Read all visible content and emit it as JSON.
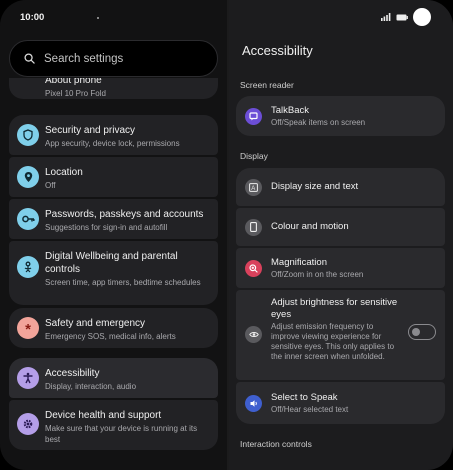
{
  "status_bar": {
    "time": "10:00"
  },
  "search": {
    "placeholder": "Search settings"
  },
  "left_menu": [
    {
      "title": "About phone",
      "subtitle": "Pixel 10 Pro Fold",
      "icon": "phone-icon",
      "color": "#3a3a3e"
    },
    {
      "title": "Security and privacy",
      "subtitle": "App security, device lock, permissions",
      "icon": "shield-icon",
      "color": "#7fcfea"
    },
    {
      "title": "Location",
      "subtitle": "Off",
      "icon": "location-pin-icon",
      "color": "#7fcfea"
    },
    {
      "title": "Passwords, passkeys and accounts",
      "subtitle": "Suggestions for sign-in and autofill",
      "icon": "key-icon",
      "color": "#7fcfea"
    },
    {
      "title": "Digital Wellbeing and parental controls",
      "subtitle": "Screen time, app timers, bedtime schedules",
      "icon": "wellbeing-icon",
      "color": "#7fcfea"
    },
    {
      "title": "Safety and emergency",
      "subtitle": "Emergency SOS, medical info, alerts",
      "icon": "asterisk-icon",
      "color": "#f2a49a"
    },
    {
      "title": "Accessibility",
      "subtitle": "Display, interaction, audio",
      "icon": "accessibility-icon",
      "color": "#b49ee8"
    },
    {
      "title": "Device health and support",
      "subtitle": "Make sure that your device is running at its best",
      "icon": "gear-icon",
      "color": "#b49ee8"
    }
  ],
  "right": {
    "title": "Accessibility",
    "sections": {
      "screen_reader": "Screen reader",
      "display": "Display",
      "interaction": "Interaction controls"
    },
    "talkback": {
      "title": "TalkBack",
      "subtitle": "Off/Speak items on screen",
      "icon": "talkback-icon",
      "color": "#6c4ed6"
    },
    "display_items": [
      {
        "title": "Display size and text",
        "subtitle": "",
        "icon": "text-size-icon",
        "color": "#5a5a5e"
      },
      {
        "title": "Colour and motion",
        "subtitle": "",
        "icon": "phone-screen-icon",
        "color": "#5a5a5e"
      },
      {
        "title": "Magnification",
        "subtitle": "Off/Zoom in on the screen",
        "icon": "zoom-icon",
        "color": "#d9415c"
      },
      {
        "title": "Adjust brightness for sensitive eyes",
        "subtitle": "Adjust emission frequency to improve viewing experience for sensitive eyes. This only applies to the inner screen when unfolded.",
        "icon": "eye-icon",
        "color": "#5a5a5e",
        "toggle": false
      },
      {
        "title": "Select to Speak",
        "subtitle": "Off/Hear selected text",
        "icon": "select-to-speak-icon",
        "color": "#3f5fcf"
      }
    ]
  }
}
